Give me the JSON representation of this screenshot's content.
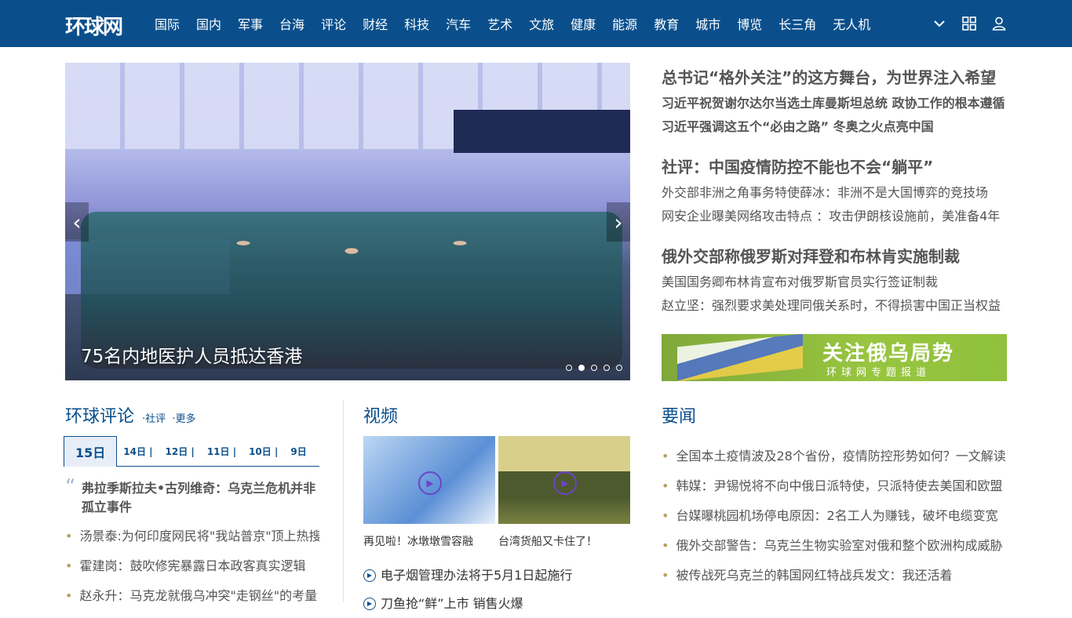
{
  "nav": {
    "logo": "环球网",
    "items": [
      "国际",
      "国内",
      "军事",
      "台海",
      "评论",
      "财经",
      "科技",
      "汽车",
      "艺术",
      "文旅",
      "健康",
      "能源",
      "教育",
      "城市",
      "博览",
      "长三角",
      "无人机"
    ]
  },
  "hero": {
    "caption": "75名内地医护人员抵达香港",
    "dots": 5,
    "active_dot": 2
  },
  "headlines": [
    {
      "title": "总书记“格外关注”的这方舞台，为世界注入希望",
      "subs": [
        "习近平祝贺谢尔达尔当选土库曼斯坦总统 政协工作的根本遵循",
        "习近平强调这五个“必由之路” 冬奥之火点亮中国"
      ],
      "bold_subs": true
    },
    {
      "title": "社评：中国疫情防控不能也不会“躺平”",
      "subs": [
        "外交部非洲之角事务特使薛冰：非洲不是大国博弈的竞技场",
        "网安企业曝美网络攻击特点 ：攻击伊朗核设施前，美准备4年"
      ],
      "bold_subs": false
    },
    {
      "title": "俄外交部称俄罗斯对拜登和布林肯实施制裁",
      "subs": [
        "美国国务卿布林肯宣布对俄罗斯官员实行签证制裁",
        "赵立坚：强烈要求美处理同俄关系时，不得损害中国正当权益"
      ],
      "bold_subs": false
    }
  ],
  "ad": {
    "title": "关注俄乌局势",
    "subtitle": "环球网专题报道"
  },
  "commentary": {
    "title": "环球评论",
    "sublinks": [
      "社评",
      "更多"
    ],
    "tabs": [
      "15日",
      "14日",
      "12日",
      "11日",
      "10日",
      "9日"
    ],
    "quote": "弗拉季斯拉夫•古列维奇：乌克兰危机并非孤立事件",
    "items": [
      "汤景泰:为何印度网民将\"我站普京\"顶上热搜",
      "霍建岗：鼓吹修宪暴露日本政客真实逻辑",
      "赵永升：马克龙就俄乌冲突\"走钢丝\"的考量"
    ]
  },
  "video": {
    "title": "视频",
    "thumbs": [
      {
        "caption": "再见啦！冰墩墩雪容融"
      },
      {
        "caption": "台湾货船又卡住了！"
      }
    ],
    "items": [
      "电子烟管理办法将于5月1日起施行",
      "刀鱼抢“鲜”上市 销售火爆"
    ]
  },
  "news": {
    "title": "要闻",
    "items": [
      "全国本土疫情波及28个省份，疫情防控形势如何？一文解读",
      "韩媒：尹锡悦将不向中俄日派特使，只派特使去美国和欧盟",
      "台媒曝桃园机场停电原因：2名工人为赚钱，破坏电缆变宽",
      "俄外交部警告：乌克兰生物实验室对俄和整个欧洲构成威胁",
      "被传战死乌克兰的韩国网红特战兵发文：我还活着"
    ]
  },
  "colors": {
    "brand": "#0a4f8c",
    "bullet": "#b8a060"
  }
}
